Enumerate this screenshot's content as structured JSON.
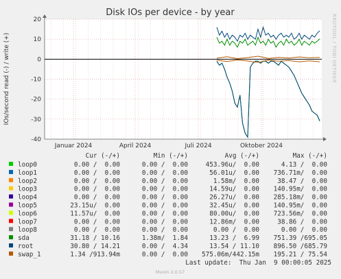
{
  "chart_data": {
    "type": "line",
    "title": "Disk IOs per device - by year",
    "ylabel": "IOs/second read (-) / write (+)",
    "side_label": "RRDTOOL / TOBI OETIKER",
    "footer": "Munin 2.0.57",
    "last_update": "Last update:  Thu Jan  9 00:00:05 2025",
    "ylim": [
      -40,
      20
    ],
    "yticks": [
      20,
      10,
      0,
      -10,
      -20,
      -30,
      -40
    ],
    "x_dates": [
      "Januar 2024",
      "April 2024",
      "Juli 2024",
      "Oktober 2024"
    ],
    "columns": [
      "Cur (-/+)",
      "Min (-/+)",
      "Avg (-/+)",
      "Max (-/+)"
    ],
    "legend": [
      {
        "name": "loop0",
        "color": "#00cc00",
        "cur": " 0.00 /  0.00",
        "min": " 0.00 /  0.00",
        "avg": "453.96u/  0.00",
        "max": "  4.13 /  0.00"
      },
      {
        "name": "loop1",
        "color": "#0066b3",
        "cur": " 0.00 /  0.00",
        "min": " 0.00 /  0.00",
        "avg": " 56.01u/  0.00",
        "max": "736.71m/  0.00"
      },
      {
        "name": "loop2",
        "color": "#ff8000",
        "cur": " 0.00 /  0.00",
        "min": " 0.00 /  0.00",
        "avg": "  1.58m/  0.00",
        "max": " 38.47 /  0.00"
      },
      {
        "name": "loop3",
        "color": "#ffcc00",
        "cur": " 0.00 /  0.00",
        "min": " 0.00 /  0.00",
        "avg": " 14.59u/  0.00",
        "max": "140.95m/  0.00"
      },
      {
        "name": "loop4",
        "color": "#330099",
        "cur": " 0.00 /  0.00",
        "min": " 0.00 /  0.00",
        "avg": " 26.27u/  0.00",
        "max": "285.18m/  0.00"
      },
      {
        "name": "loop5",
        "color": "#990099",
        "cur": "23.15u/  0.00",
        "min": " 0.00 /  0.00",
        "avg": " 32.45u/  0.00",
        "max": "140.95m/  0.00"
      },
      {
        "name": "loop6",
        "color": "#ccff00",
        "cur": "11.57u/  0.00",
        "min": " 0.00 /  0.00",
        "avg": " 80.00u/  0.00",
        "max": "723.56m/  0.00"
      },
      {
        "name": "loop7",
        "color": "#ff0000",
        "cur": " 0.00 /  0.00",
        "min": " 0.00 /  0.00",
        "avg": " 12.86m/  0.00",
        "max": " 38.86 /  0.00"
      },
      {
        "name": "loop8",
        "color": "#808080",
        "cur": " 0.00 /  0.00",
        "min": " 0.00 /  0.00",
        "avg": "  0.00 /  0.00",
        "max": "  0.00 /  0.00"
      },
      {
        "name": "sda",
        "color": "#008f00",
        "cur": "31.18 / 10.16",
        "min": " 1.38m/  1.84",
        "avg": " 13.23 /  6.99",
        "max": "751.39 /695.05"
      },
      {
        "name": "root",
        "color": "#00487d",
        "cur": "30.80 / 14.21",
        "min": " 0.00 /  4.34",
        "avg": " 13.54 / 11.10",
        "max": "896.50 /685.79"
      },
      {
        "name": "swap_1",
        "color": "#b35a00",
        "cur": " 1.34 /913.94m",
        "min": " 0.00 /  0.00",
        "avg": "575.06m/442.15m",
        "max": "195.21 / 75.54"
      }
    ],
    "series": [
      {
        "name": "sda",
        "color": "#008f00",
        "direction": "write",
        "x": [
          0,
          1,
          2,
          3,
          4,
          5,
          6,
          7,
          8,
          9,
          10,
          11,
          12,
          13,
          14,
          15,
          16,
          17,
          18,
          19,
          20,
          21,
          22,
          23,
          24,
          25,
          26,
          27,
          28,
          29,
          30,
          31,
          32,
          33,
          34,
          35,
          36,
          37,
          38,
          39,
          40
        ],
        "y": [
          11,
          8,
          9,
          7,
          10,
          7,
          9,
          8,
          6,
          9,
          8,
          10,
          7,
          8,
          9,
          7,
          11,
          8,
          9,
          7,
          10,
          8,
          9,
          6,
          8,
          9,
          7,
          10,
          8,
          9,
          7,
          8,
          10,
          7,
          9,
          8,
          7,
          9,
          8,
          9,
          10.2
        ]
      },
      {
        "name": "root",
        "color": "#00487d",
        "direction": "write",
        "x": [
          0,
          1,
          2,
          3,
          4,
          5,
          6,
          7,
          8,
          9,
          10,
          11,
          12,
          13,
          14,
          15,
          16,
          17,
          18,
          19,
          20,
          21,
          22,
          23,
          24,
          25,
          26,
          27,
          28,
          29,
          30,
          31,
          32,
          33,
          34,
          35,
          36,
          37,
          38,
          39,
          40
        ],
        "y": [
          16,
          12,
          14,
          11,
          13,
          10,
          12,
          11,
          9,
          12,
          11,
          13,
          10,
          12,
          11,
          10,
          15,
          11,
          16,
          12,
          13,
          11,
          12,
          10,
          12,
          13,
          11,
          12,
          11,
          13,
          10,
          11,
          13,
          10,
          12,
          11,
          10,
          12,
          11,
          13,
          14.2
        ]
      },
      {
        "name": "sda",
        "color": "#008f00",
        "direction": "read",
        "x": [
          0,
          1,
          2,
          3,
          4,
          5,
          6,
          7,
          8,
          9,
          10,
          11,
          12,
          13,
          14,
          15,
          16,
          17,
          18,
          19,
          20,
          21,
          22,
          23,
          24,
          25,
          26,
          27,
          28,
          29,
          30,
          31,
          32,
          33,
          34,
          35,
          36,
          37,
          38,
          39,
          40
        ],
        "y": [
          -1,
          -3,
          -2,
          -5,
          -9,
          -12,
          -16,
          -22,
          -24,
          -18,
          -32,
          -37,
          -39,
          -4,
          -2,
          -1,
          -1,
          -2,
          -1,
          -1,
          -2,
          -1,
          -1,
          -2,
          -3,
          -1,
          -2,
          -3,
          -4,
          -6,
          -8,
          -11,
          -14,
          -17,
          -19,
          -21,
          -23,
          -26,
          -27,
          -28,
          -31
        ]
      },
      {
        "name": "root",
        "color": "#00487d",
        "direction": "read",
        "x": [
          0,
          1,
          2,
          3,
          4,
          5,
          6,
          7,
          8,
          9,
          10,
          11,
          12,
          13,
          14,
          15,
          16,
          17,
          18,
          19,
          20,
          21,
          22,
          23,
          24,
          25,
          26,
          27,
          28,
          29,
          30,
          31,
          32,
          33,
          34,
          35,
          36,
          37,
          38,
          39,
          40
        ],
        "y": [
          -1,
          -3,
          -2,
          -5,
          -9,
          -12,
          -16,
          -22,
          -24,
          -18,
          -32,
          -37,
          -39,
          -4,
          -2,
          -1,
          -1,
          -2,
          -1,
          -1,
          -2,
          -1,
          -1,
          -2,
          -3,
          -1,
          -2,
          -3,
          -4,
          -6,
          -8,
          -11,
          -14,
          -17,
          -19,
          -21,
          -23,
          -26,
          -27,
          -28,
          -30.8
        ]
      },
      {
        "name": "swap_1",
        "color": "#b35a00",
        "direction": "write",
        "x": [
          0,
          4,
          8,
          12,
          16,
          20,
          24,
          28,
          32,
          36,
          40
        ],
        "y": [
          0.5,
          1.2,
          0.3,
          0.8,
          1.5,
          0.4,
          0.9,
          0.6,
          1.1,
          0.7,
          0.9
        ]
      },
      {
        "name": "swap_1",
        "color": "#b35a00",
        "direction": "read",
        "x": [
          0,
          4,
          8,
          12,
          16,
          20,
          24,
          28,
          32,
          36,
          40
        ],
        "y": [
          -0.5,
          -1.2,
          -0.4,
          -0.9,
          -1.6,
          -0.5,
          -1.0,
          -0.7,
          -1.3,
          -0.8,
          -1.3
        ]
      }
    ]
  }
}
